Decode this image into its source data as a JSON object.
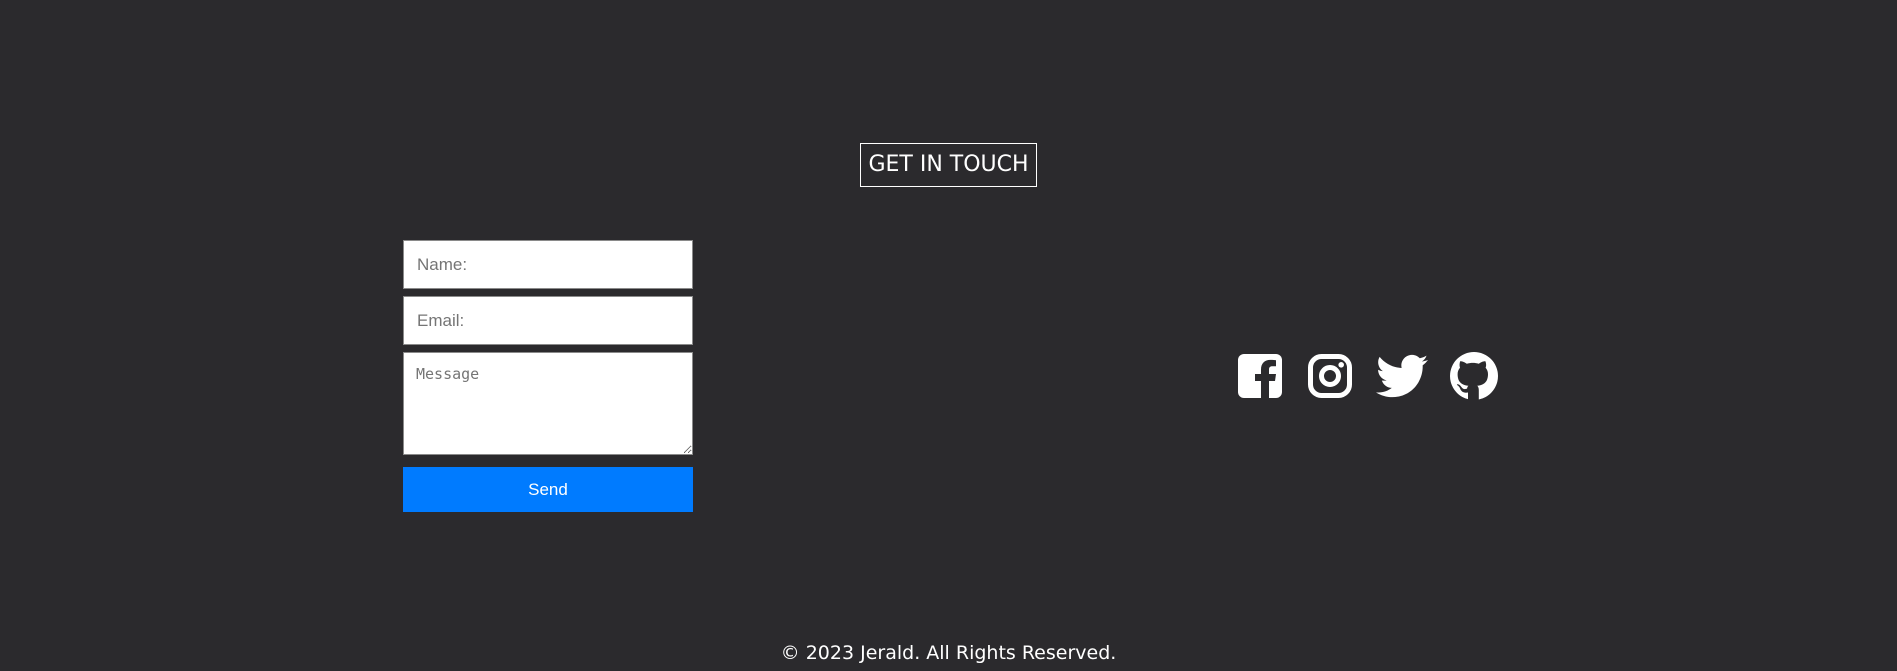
{
  "contact": {
    "title": "GET IN TOUCH",
    "name_placeholder": "Name:",
    "email_placeholder": "Email:",
    "message_placeholder": "Message",
    "send_label": "Send"
  },
  "socials": [
    {
      "name": "Facebook",
      "icon": "facebook-icon"
    },
    {
      "name": "Instagram",
      "icon": "instagram-icon"
    },
    {
      "name": "Twitter",
      "icon": "twitter-icon"
    },
    {
      "name": "GitHub",
      "icon": "github-icon"
    }
  ],
  "footer": {
    "copyright": "© 2023 Jerald. All Rights Reserved."
  },
  "colors": {
    "background": "#2b2a2d",
    "accent": "#007bff",
    "text": "#ffffff"
  }
}
